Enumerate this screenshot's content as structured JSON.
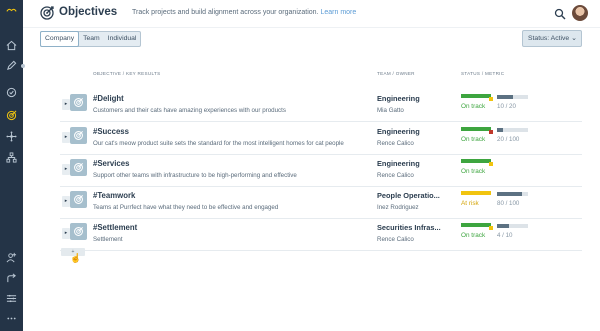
{
  "header": {
    "title": "Objectives",
    "subtitle": "Track projects and build alignment across your organization.",
    "learn_more": "Learn more"
  },
  "filters": {
    "tabs": [
      "Company",
      "Team",
      "Individual"
    ],
    "active_tab": "Company",
    "status_label": "Status: Active"
  },
  "table": {
    "columns": [
      "OBJECTIVE / KEY RESULTS",
      "TEAM / OWNER",
      "STATUS / METRIC"
    ],
    "rows": [
      {
        "title": "#Delight",
        "desc": "Customers and their cats have amazing experiences with our products",
        "team": "Engineering",
        "owner": "Mia Gatto",
        "status": "On track",
        "status_color": "#3da53f",
        "flag_color": "#f1c40f",
        "metric": "10 / 20",
        "progress": 0.5
      },
      {
        "title": "#Success",
        "desc": "Our cat's meow product suite sets the standard for the most intelligent homes for cat people",
        "team": "Engineering",
        "owner": "Rence Calico",
        "status": "On track",
        "status_color": "#3da53f",
        "flag_color": "#c0392b",
        "metric": "20 / 100",
        "progress": 0.2
      },
      {
        "title": "#Services",
        "desc": "Support other teams with infrastructure to be high-performing and effective",
        "team": "Engineering",
        "owner": "Rence Calico",
        "status": "On track",
        "status_color": "#3da53f",
        "flag_color": "#f1c40f",
        "metric": "",
        "progress": null
      },
      {
        "title": "#Teamwork",
        "desc": "Teams at Purrfect have what they need to be effective and engaged",
        "team": "People Operatio...",
        "owner": "Inez Rodriguez",
        "status": "At risk",
        "status_color": "#f1c40f",
        "flag_color": "",
        "metric": "80 / 100",
        "progress": 0.8
      },
      {
        "title": "#Settlement",
        "desc": "Settlement",
        "team": "Securities Infras...",
        "owner": "Rence Calico",
        "status": "On track",
        "status_color": "#3da53f",
        "flag_color": "#f1c40f",
        "metric": "4 / 10",
        "progress": 0.4
      }
    ]
  },
  "add_button": "+",
  "icons": {
    "sidebar": [
      "home-icon",
      "pencil-icon",
      "check-circle-icon",
      "target-icon",
      "network-icon",
      "org-chart-icon",
      "add-user-icon",
      "share-icon",
      "sliders-icon",
      "more-icon"
    ],
    "header": [
      "objectives-logo-icon",
      "search-icon"
    ]
  }
}
